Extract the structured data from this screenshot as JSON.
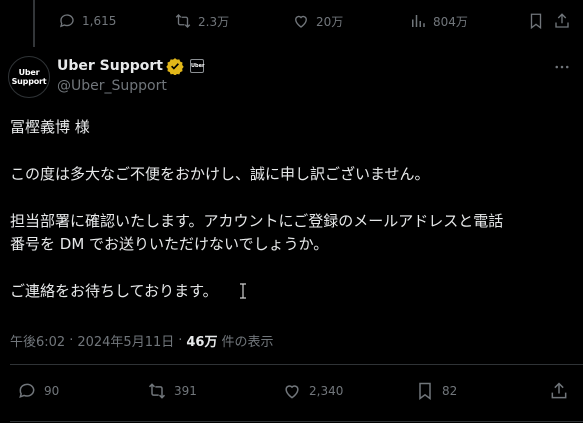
{
  "previous_tweet": {
    "replies": "1,615",
    "retweets": "2.3万",
    "likes": "20万",
    "views": "804万"
  },
  "tweet": {
    "display_name": "Uber Support",
    "handle": "@Uber_Support",
    "avatar_text_line1": "Uber",
    "avatar_text_line2": "Support",
    "affiliate_badge_text": "Uber",
    "body": {
      "line1": "冨樫義博 様",
      "line2": "この度は多大なご不便をおかけし、誠に申し訳ございません。",
      "line3": "担当部署に確認いたします。アカウントにご登録のメールアドレスと電話",
      "line4": "番号を DM でお送りいただけないでしょうか。",
      "line5": "ご連絡をお待ちしております。"
    },
    "time": "午後6:02",
    "date": "2024年5月11日",
    "views_count": "46万",
    "views_suffix": "件の表示",
    "replies": "90",
    "retweets": "391",
    "likes": "2,340",
    "bookmarks": "82"
  },
  "colors": {
    "background": "#000000",
    "text": "#e7e9ea",
    "muted": "#71767b",
    "verified_gold": "#e2b719",
    "border": "#2f3336"
  }
}
